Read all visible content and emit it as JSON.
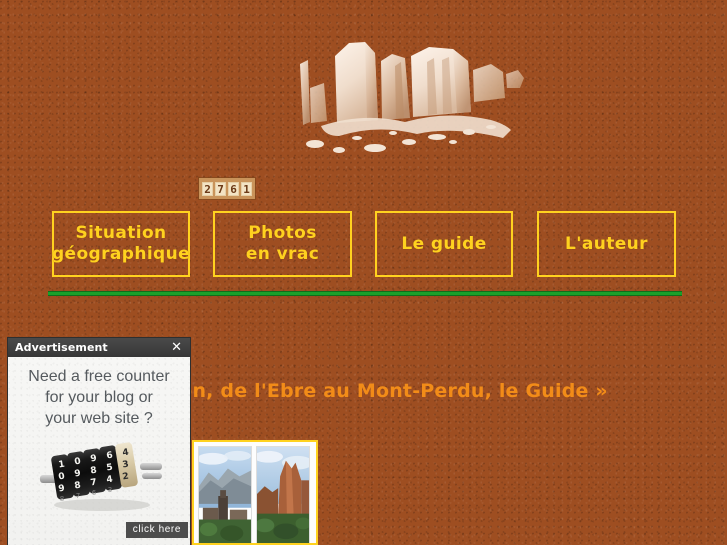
{
  "site": {
    "logo_alt": "Mallos de Riglos rock formation silhouette"
  },
  "counter": {
    "label": "visit-counter",
    "digits": [
      "2",
      "7",
      "6",
      "1"
    ],
    "value": "2761"
  },
  "nav": {
    "buttons": [
      {
        "label": "Situation\ngéographique",
        "name": "situation-geographique"
      },
      {
        "label": "Photos\nen vrac",
        "name": "photos-en-vrac"
      },
      {
        "label": "Le guide",
        "name": "le-guide"
      },
      {
        "label": "L'auteur",
        "name": "l-auteur"
      }
    ]
  },
  "main": {
    "heading": "« De l'Aragon, de l'Ebre au Mont-Perdu, le Guide »"
  },
  "ad": {
    "title": "Advertisement",
    "close_label": "✕",
    "line1": "Need a free counter",
    "line2": "for your blog or",
    "line3": "your web site ?",
    "cta": "click here"
  },
  "colors": {
    "background": "#9e4e21",
    "accent_yellow": "#ffd21f",
    "heading_orange": "#f28c18",
    "rule_green": "#1aa02a",
    "ad_titlebar": "#3b3b3b"
  }
}
